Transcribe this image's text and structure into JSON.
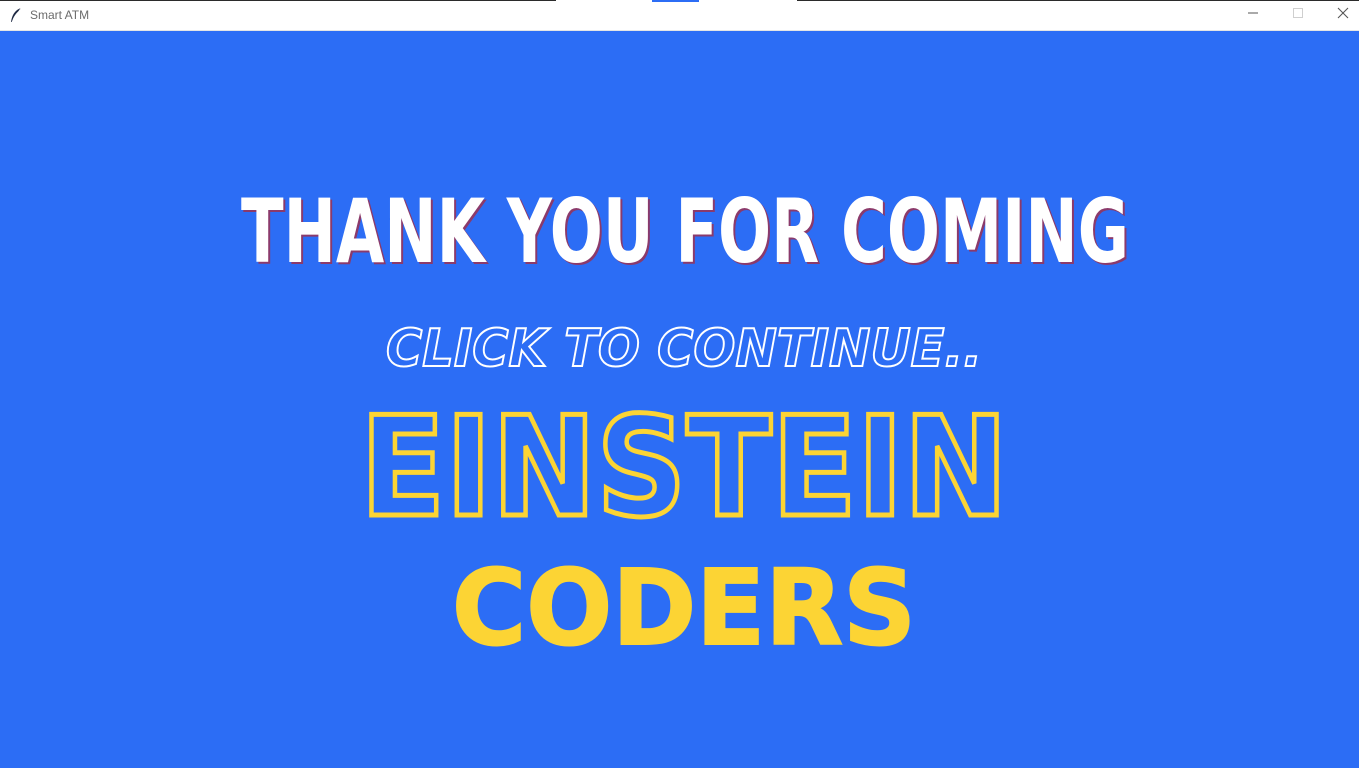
{
  "window": {
    "title": "Smart ATM"
  },
  "screen": {
    "heading": "THANK YOU FOR COMING",
    "prompt": "CLICK TO CONTINUE..",
    "brand_line1": "EINSTEIN",
    "brand_line2": "CODERS"
  },
  "colors": {
    "background": "#2c6df5",
    "heading": "#ffffff",
    "heading_shadow": "#8b3a6b",
    "outline_white": "#ffffff",
    "brand": "#fcd434"
  },
  "icons": {
    "app": "feather-icon",
    "minimize": "minimize-icon",
    "maximize": "maximize-icon",
    "close": "close-icon"
  }
}
